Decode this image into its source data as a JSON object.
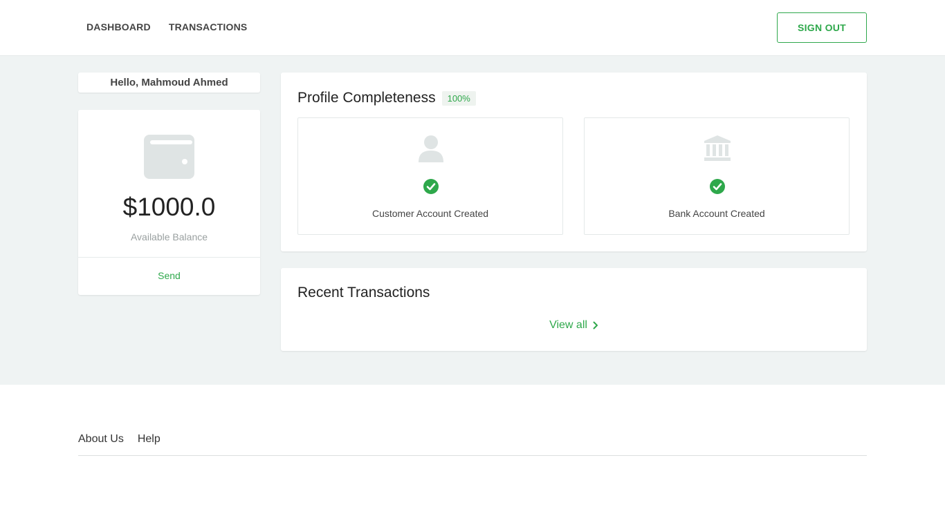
{
  "header": {
    "nav": [
      {
        "label": "DASHBOARD"
      },
      {
        "label": "TRANSACTIONS"
      }
    ],
    "signout_label": "SIGN OUT"
  },
  "greeting": "Hello, Mahmoud Ahmed",
  "wallet": {
    "icon": "wallet-icon",
    "balance": "$1000.0",
    "balance_label": "Available Balance",
    "send_label": "Send"
  },
  "profile": {
    "title": "Profile Completeness",
    "percent": "100%",
    "items": [
      {
        "icon": "user-icon",
        "status_icon": "check-circle-icon",
        "label": "Customer Account Created"
      },
      {
        "icon": "bank-icon",
        "status_icon": "check-circle-icon",
        "label": "Bank Account Created"
      }
    ]
  },
  "recent": {
    "title": "Recent Transactions",
    "view_all_label": "View all"
  },
  "footer": {
    "links": [
      {
        "label": "About Us"
      },
      {
        "label": "Help"
      }
    ]
  },
  "colors": {
    "accent": "#2ea84b",
    "background": "#eff3f3",
    "icon_gray": "#dfe4e4"
  }
}
